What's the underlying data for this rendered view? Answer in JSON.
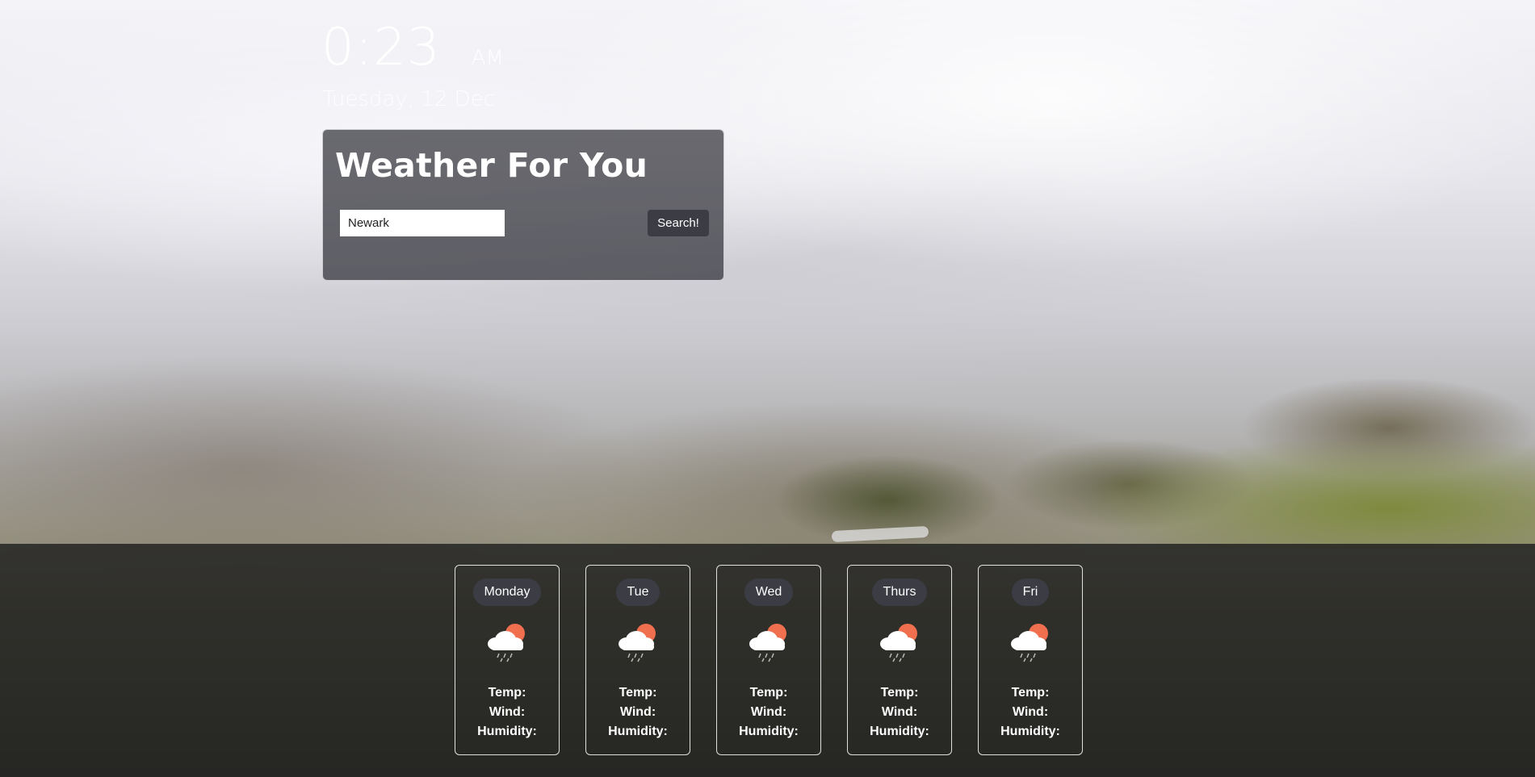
{
  "clock": {
    "time": "0:23",
    "ampm": "AM"
  },
  "date": "Tuesday, 12 Dec",
  "search": {
    "title": "Weather For You",
    "input_value": "Newark",
    "button_label": "Search!"
  },
  "forecast": [
    {
      "day": "Monday",
      "icon": "cloud-sun-rain-icon",
      "temp_label": "Temp:",
      "wind_label": "Wind:",
      "humidity_label": "Humidity:"
    },
    {
      "day": "Tue",
      "icon": "cloud-sun-rain-icon",
      "temp_label": "Temp:",
      "wind_label": "Wind:",
      "humidity_label": "Humidity:"
    },
    {
      "day": "Wed",
      "icon": "cloud-sun-rain-icon",
      "temp_label": "Temp:",
      "wind_label": "Wind:",
      "humidity_label": "Humidity:"
    },
    {
      "day": "Thurs",
      "icon": "cloud-sun-rain-icon",
      "temp_label": "Temp:",
      "wind_label": "Wind:",
      "humidity_label": "Humidity:"
    },
    {
      "day": "Fri",
      "icon": "cloud-sun-rain-icon",
      "temp_label": "Temp:",
      "wind_label": "Wind:",
      "humidity_label": "Humidity:"
    }
  ],
  "colors": {
    "sun": "#ef6f4f",
    "cloud": "#ffffff",
    "pill": "#3b3c44",
    "button": "#3b3c44"
  }
}
